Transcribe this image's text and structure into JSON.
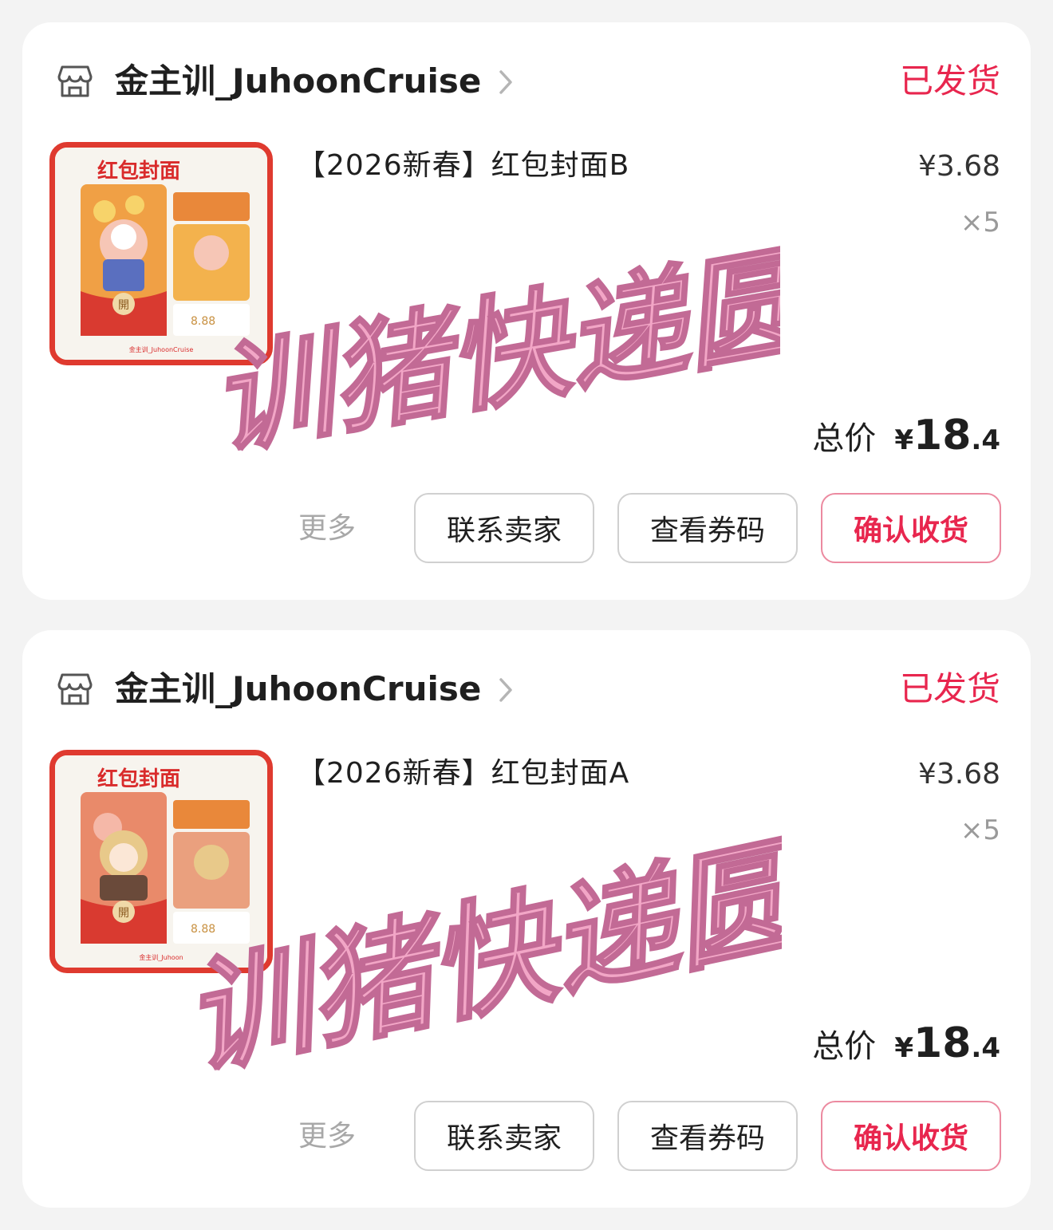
{
  "orders": [
    {
      "shop_name": "金主训_JuhoonCruise",
      "status": "已发货",
      "product": {
        "title": "【2026新春】红包封面B",
        "price": "¥3.68",
        "quantity": "×5",
        "thumbnail": {
          "heading": "红包封面",
          "open_label": "開",
          "amount": "8.88",
          "footer": "金主训_JuhoonCruise"
        }
      },
      "total": {
        "label": "总价",
        "currency": "¥",
        "integer": "18",
        "decimal": ".4"
      },
      "actions": {
        "more": "更多",
        "contact": "联系卖家",
        "coupon": "查看券码",
        "confirm": "确认收货"
      }
    },
    {
      "shop_name": "金主训_JuhoonCruise",
      "status": "已发货",
      "product": {
        "title": "【2026新春】红包封面A",
        "price": "¥3.68",
        "quantity": "×5",
        "thumbnail": {
          "heading": "红包封面",
          "open_label": "開",
          "amount": "8.88",
          "footer": "金主训_Juhoon"
        }
      },
      "total": {
        "label": "总价",
        "currency": "¥",
        "integer": "18",
        "decimal": ".4"
      },
      "actions": {
        "more": "更多",
        "contact": "联系卖家",
        "coupon": "查看券码",
        "confirm": "确认收货"
      }
    }
  ],
  "watermark_text": "训猪快递圆",
  "colors": {
    "accent": "#e8264e",
    "accent_border": "#ec8aa0",
    "thumb_border": "#df3a2f",
    "watermark": "#f2a6c6",
    "background": "#f3f3f3"
  }
}
